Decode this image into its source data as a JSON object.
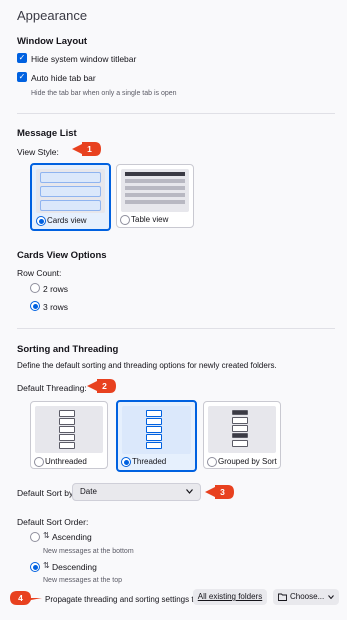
{
  "page": {
    "title": "Appearance"
  },
  "window_layout": {
    "heading": "Window Layout",
    "hide_titlebar_label": "Hide system window titlebar",
    "auto_hide_tab_bar_label": "Auto hide tab bar",
    "auto_hide_hint": "Hide the tab bar when only a single tab is open"
  },
  "message_list": {
    "heading": "Message List",
    "view_style_label": "View Style:",
    "cards_view_label": "Cards view",
    "table_view_label": "Table view",
    "selected_view": "Cards view"
  },
  "cards_view_options": {
    "heading": "Cards View Options",
    "row_count_label": "Row Count:",
    "options": [
      "2 rows",
      "3 rows"
    ],
    "selected": "3 rows"
  },
  "sorting": {
    "heading": "Sorting and Threading",
    "description": "Define the default sorting and threading options for newly created folders.",
    "default_threading_label": "Default Threading:",
    "threading_options": [
      "Unthreaded",
      "Threaded",
      "Grouped by Sort"
    ],
    "selected_threading": "Threaded",
    "default_sort_by_label": "Default Sort by:",
    "sort_by_value": "Date",
    "sort_order_label": "Default Sort Order:",
    "ascending_label": "Ascending",
    "ascending_hint": "New messages at the bottom",
    "descending_label": "Descending",
    "descending_hint": "New messages at the top",
    "selected_order": "Descending",
    "propagate_label": "Propagate threading and sorting settings to:",
    "all_folders_button": "All existing folders",
    "choose_button": "Choose..."
  },
  "callouts": [
    "1",
    "2",
    "3",
    "4"
  ],
  "colors": {
    "accent": "#0061e0",
    "callout": "#e8411f",
    "background": "#f9f9fb"
  },
  "icons": {
    "checkbox": "checkmark-icon",
    "ascending": "sort-ascending-icon",
    "descending": "sort-descending-icon",
    "folder": "folder-icon",
    "dropdown": "chevron-down-icon"
  }
}
